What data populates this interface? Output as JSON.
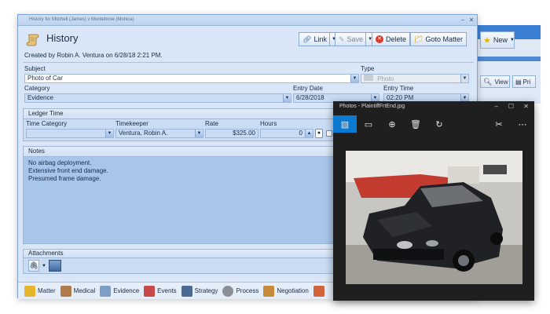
{
  "background_app": {
    "new_label": "New",
    "view_label": "View",
    "print_label": "Pri"
  },
  "window": {
    "title": "History for Mitchell (James) v Montebose (Monica)",
    "heading": "History",
    "created_by": "Created by Robin A. Ventura on 6/28/18 2:21 PM."
  },
  "toolbar": {
    "link_label": "Link",
    "save_label": "Save",
    "delete_label": "Delete",
    "goto_label": "Goto Matter"
  },
  "form": {
    "subject_label": "Subject",
    "subject_value": "Photo of Car",
    "type_label": "Type",
    "type_value": "Photo",
    "category_label": "Category",
    "category_value": "Evidence",
    "entry_date_label": "Entry Date",
    "entry_date_value": "6/28/2018",
    "entry_time_label": "Entry Time",
    "entry_time_value": "02:20 PM"
  },
  "ledger": {
    "section_label": "Ledger Time",
    "time_category_label": "Time Category",
    "time_category_value": "",
    "timekeeper_label": "Timekeeper",
    "timekeeper_value": "Ventura, Robin A.",
    "rate_label": "Rate",
    "rate_value": "$325.00",
    "hours_label": "Hours",
    "hours_value": "0"
  },
  "notes": {
    "section_label": "Notes",
    "lines": [
      "No airbag deployment.",
      "Extensive front end damage.",
      "Presumed frame damage."
    ]
  },
  "attachments": {
    "section_label": "Attachments"
  },
  "bottom_nav": [
    "Matter",
    "Medical",
    "Evidence",
    "Events",
    "Strategy",
    "Process",
    "Negotiation"
  ],
  "photos": {
    "title": "Photos - PlaintiffFrtEnd.jpg"
  },
  "colors": {
    "accent": "#0b7ad0",
    "window_bg": "#d8e6f7",
    "field_highlight": "#c9dcf4"
  }
}
